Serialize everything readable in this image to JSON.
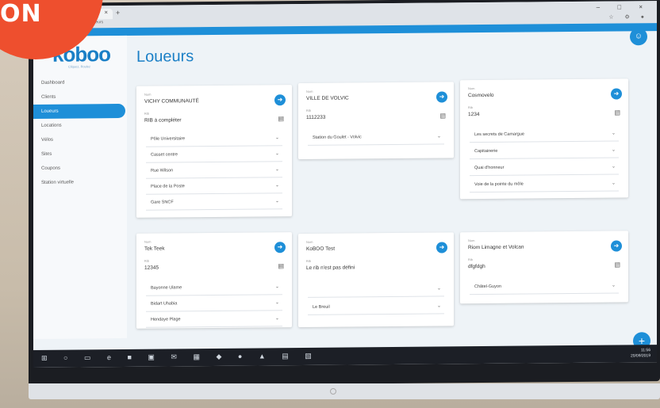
{
  "badge": {
    "text": "ON"
  },
  "browser": {
    "tab_close": "×",
    "new_tab": "+",
    "window_controls": "–  □  ×",
    "address": "koboo3.openum.fr/loueurs",
    "toolbar_icons": "☆ ⚙ ●"
  },
  "app": {
    "logo": "koboo",
    "tagline": "Cliquez, Roulez",
    "page_title": "Loueurs",
    "avatar_icon": "☺"
  },
  "sidebar": {
    "items": [
      {
        "label": "Dashboard",
        "active": false
      },
      {
        "label": "Clients",
        "active": false
      },
      {
        "label": "Loueurs",
        "active": true
      },
      {
        "label": "Locations",
        "active": false
      },
      {
        "label": "Vélos",
        "active": false
      },
      {
        "label": "Sites",
        "active": false
      },
      {
        "label": "Coupons",
        "active": false
      },
      {
        "label": "Station virtuelle",
        "active": false
      }
    ]
  },
  "labels": {
    "name": "Nom",
    "rib": "Rib"
  },
  "cards": [
    {
      "name": "VICHY COMMUNAUTÉ",
      "rib": "RIB à compléter",
      "sites": [
        "Pôle Universitaire",
        "Casset centre",
        "Rue Wilson",
        "Place de la Poste",
        "Gare SNCF"
      ]
    },
    {
      "name": "VILLE DE VOLVIC",
      "rib": "1112233",
      "sites": [
        "Station du Goulet - Volvic"
      ]
    },
    {
      "name": "Cosmovelo",
      "rib": "1234",
      "sites": [
        "Les secrets de Camargue",
        "Capitainerie",
        "Quai d'honneur",
        "Voie de la pointe du môle"
      ]
    },
    {
      "name": "Tek Teek",
      "rib": "12345",
      "sites": [
        "Bayonne Ulame",
        "Bidart Uhabia",
        "Hendaye Plage"
      ]
    },
    {
      "name": "KoBOO Test",
      "rib": "Le rib n'est pas défini",
      "sites": [
        "",
        "Le Breuil"
      ]
    },
    {
      "name": "Riom Limagne et Volcan",
      "rib": "dfgfdgh",
      "sites": [
        "Châtel-Guyon"
      ]
    }
  ],
  "fab_icon": "+",
  "taskbar": {
    "icons": "⊞ ○ ▭ e ■ ▣ ✉ ▦ ◆ ● ▲ ▤ ▧",
    "time": "11:56",
    "date": "20/09/2019"
  },
  "colors": {
    "primary": "#1e8fd8",
    "badge": "#ee4f2e"
  }
}
